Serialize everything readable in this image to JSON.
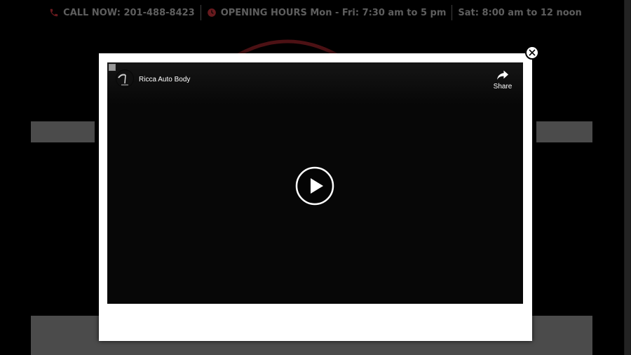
{
  "topbar": {
    "call_label": "CALL NOW: 201-488-8423",
    "hours_label": "OPENING HOURS Mon - Fri: 7:30 am to 5 pm",
    "saturday_label": "Sat: 8:00 am to 12 noon",
    "accent_color": "#7a1f24"
  },
  "modal": {
    "close_label": "X"
  },
  "video": {
    "channel_name": "Ricca Auto Body",
    "share_label": "Share"
  },
  "icons": {
    "phone": "phone-icon",
    "clock": "clock-icon",
    "close": "close-icon",
    "share": "share-icon",
    "play": "play-icon"
  }
}
